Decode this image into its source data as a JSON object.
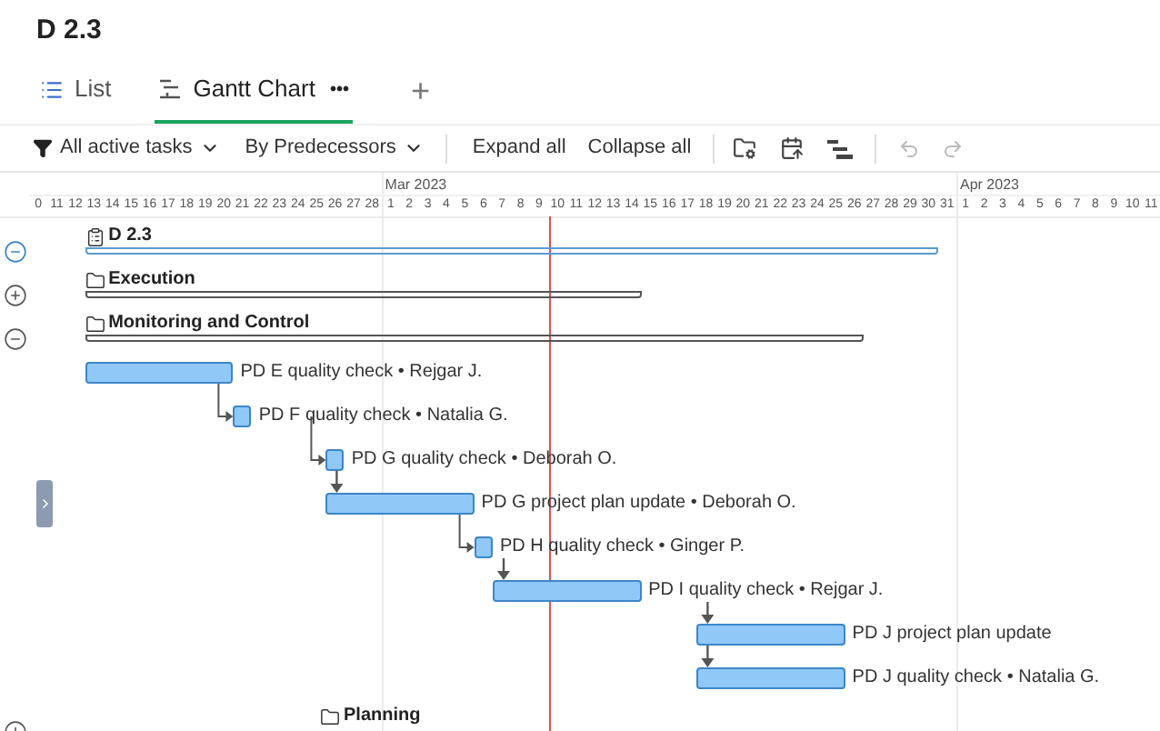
{
  "page_title": "D 2.3",
  "view_tabs": [
    {
      "kind": "list",
      "label": "List",
      "selected": false
    },
    {
      "kind": "gantt",
      "label": "Gantt Chart",
      "menu": "•••",
      "selected": true
    }
  ],
  "add_tab": "+",
  "toolbar": {
    "filter": "All active tasks",
    "grouping": "By Predecessors",
    "expand_all": "Expand all",
    "collapse_all": "Collapse all",
    "undo_disabled": true,
    "redo_disabled": true
  },
  "timeline": {
    "months": [
      {
        "days": [
          "0",
          "11",
          "12",
          "13",
          "14",
          "15",
          "16",
          "17",
          "18",
          "19",
          "20",
          "21",
          "22",
          "23",
          "24",
          "25",
          "26",
          "27",
          "28"
        ]
      },
      {
        "label": "Mar 2023",
        "days": [
          "1",
          "2",
          "3",
          "4",
          "5",
          "6",
          "7",
          "8",
          "9",
          "10",
          "11",
          "12",
          "13",
          "14",
          "15",
          "16",
          "17",
          "18",
          "19",
          "20",
          "21",
          "22",
          "23",
          "24",
          "25",
          "26",
          "27",
          "28",
          "29",
          "30",
          "31"
        ]
      },
      {
        "label": "Apr 2023",
        "days": [
          "1",
          "2",
          "3",
          "4",
          "5",
          "6",
          "7",
          "8",
          "9",
          "10",
          "11"
        ]
      }
    ]
  },
  "rows": [
    {
      "kind": "project",
      "label": "D 2.3",
      "expanded": true
    },
    {
      "kind": "phase",
      "label": "Execution",
      "expanded": false
    },
    {
      "kind": "phase",
      "label": "Monitoring and Control",
      "expanded": true
    },
    {
      "kind": "task",
      "label": "PD E quality check • Rejgar J."
    },
    {
      "kind": "task",
      "label": "PD F quality check • Natalia G."
    },
    {
      "kind": "task",
      "label": "PD G quality check • Deborah O."
    },
    {
      "kind": "task",
      "label": "PD G project plan update • Deborah O."
    },
    {
      "kind": "task",
      "label": "PD H quality check • Ginger P."
    },
    {
      "kind": "task",
      "label": "PD I quality check • Rejgar J."
    },
    {
      "kind": "task",
      "label": "PD J project plan update"
    },
    {
      "kind": "task",
      "label": "PD J quality check • Natalia G."
    },
    {
      "kind": "phase",
      "label": "Planning",
      "expanded": false
    }
  ]
}
